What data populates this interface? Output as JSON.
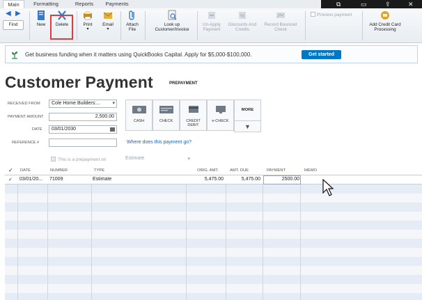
{
  "tabs": [
    "Main",
    "Formatting",
    "Reports",
    "Payments"
  ],
  "toolbar": {
    "find": "Find",
    "new": "New",
    "delete": "Delete",
    "print": "Print",
    "email": "Email",
    "attach_file": "Attach File",
    "lookup": "Look up Customer/Invoice",
    "unapply": "Un-Apply Payment",
    "discounts": "Discounts And Credits",
    "record_bounced": "Record Bounced Check",
    "process_payment": "Process payment",
    "add_credit_card": "Add Credit Card Processing"
  },
  "banner": {
    "text": "Get business funding when it matters using QuickBooks Capital. Apply for $5,000-$100,000.",
    "button": "Get started"
  },
  "title": "Customer Payment",
  "badge": "PREPAYMENT",
  "form": {
    "received_from_label": "RECEIVED FROM",
    "received_from_value": "Cole Home Builders:...",
    "payment_amount_label": "PAYMENT AMOUNT",
    "payment_amount_value": "2,500.00",
    "date_label": "DATE",
    "date_value": "03/01/2030",
    "reference_label": "REFERENCE #",
    "reference_value": ""
  },
  "payment_methods": [
    "CASH",
    "CHECK",
    "CREDIT DEBIT",
    "e-CHECK"
  ],
  "more_label": "MORE",
  "where_link": "Where does this payment go?",
  "prepayment_text": "This is a prepayment on",
  "prepayment_value": "Estimate",
  "table": {
    "headers": [
      "✓",
      "DATE",
      "NUMBER",
      "TYPE",
      "ORIG. AMT.",
      "AMT. DUE",
      "PAYMENT",
      "MEMO"
    ],
    "rows": [
      {
        "check": "✓",
        "date": "03/01/20...",
        "number": "71009",
        "type": "Estimate",
        "orig_amt": "5,475.00",
        "amt_due": "5,475.00",
        "payment": "2500.00",
        "memo": ""
      }
    ]
  },
  "colors": {
    "accent": "#0077c5",
    "highlight_box": "#e03a3a",
    "row_alt": "#e6ecf5",
    "link": "#1b63b8"
  }
}
